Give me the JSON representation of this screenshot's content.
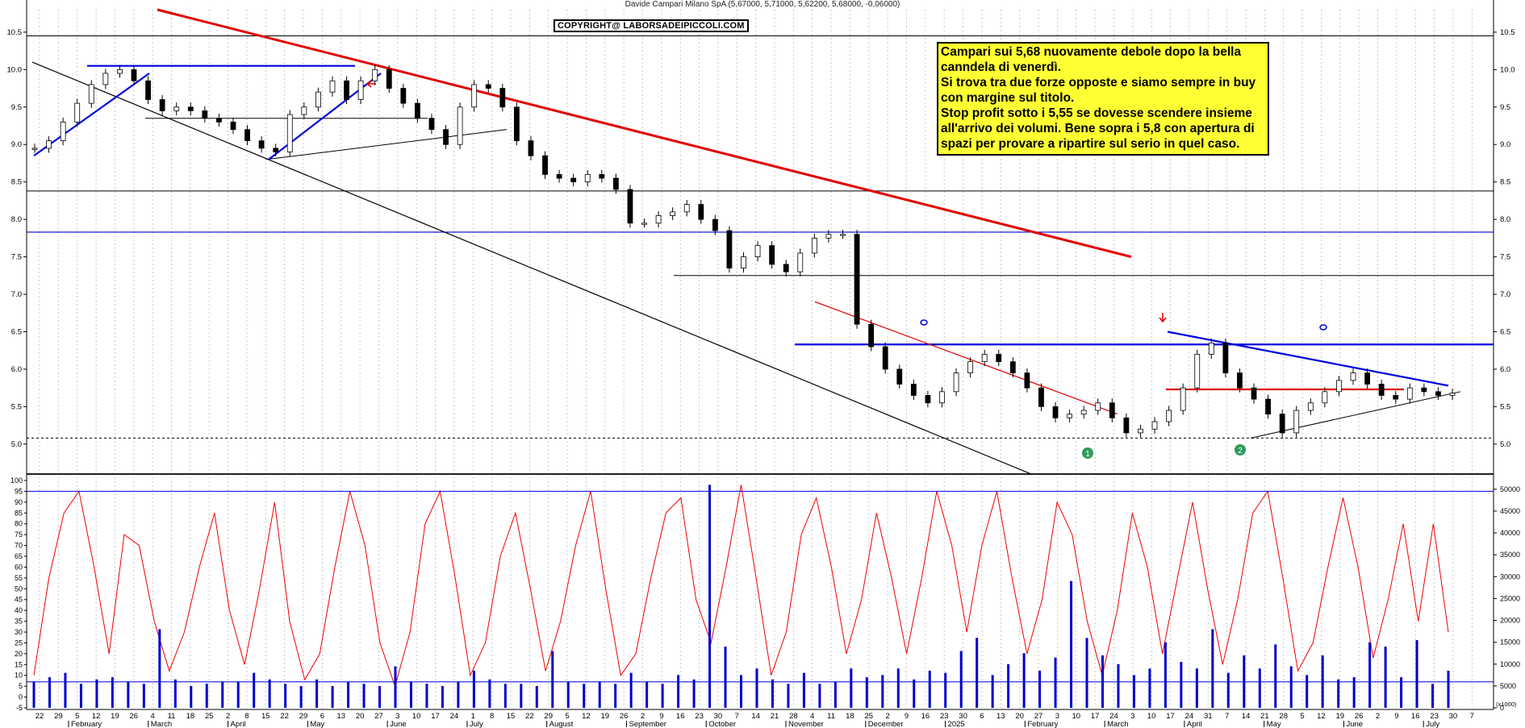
{
  "header": {
    "title": "Davide Campari Milano SpA (5,67000, 5,71000, 5,62200, 5,68000, -0,06000)"
  },
  "copyright": "COPYRIGHT@ LABORSADEIPICCOLI.COM",
  "note": {
    "lines": [
      "Campari sui 5,68 nuovamente debole dopo la bella canndela di venerdì.",
      "Si trova tra due forze opposte e siamo sempre in buy con margine sul titolo.",
      "Stop profit sotto i 5,55 se dovesse scendere insieme all'arrivo dei volumi. Bene sopra i 5,8 con apertura di spazi per provare a ripartire sul serio in quel caso."
    ]
  },
  "colors": {
    "price_candle": "#000000",
    "red_trend": "#e00000",
    "blue_line": "#0000dd",
    "oscillator": "#ee0000",
    "volume": "#0000cc",
    "note_bg": "#ffff33",
    "marker_green": "#2e9b5a"
  },
  "chart_data": [
    {
      "type": "candlestick",
      "title": "Davide Campari Milano SpA (5,67000, 5,71000, 5,62200, 5,68000, -0,06000)",
      "ylim": [
        4.6,
        10.8
      ],
      "y_ticks_left": [
        "10.5",
        "10.0",
        "9.5",
        "9.0",
        "8.5",
        "8.0",
        "7.5",
        "7.0",
        "6.5",
        "6.0",
        "5.5",
        "5.0"
      ],
      "y_ticks_right": [
        "10.5",
        "10.0",
        "9.5",
        "9.0",
        "8.5",
        "8.0",
        "7.5",
        "7.0",
        "6.5",
        "6.0",
        "5.5",
        "5.0"
      ],
      "x_day_labels": [
        "22",
        "29",
        "5",
        "12",
        "19",
        "26",
        "4",
        "11",
        "18",
        "25",
        "2",
        "8",
        "15",
        "22",
        "29",
        "6",
        "13",
        "20",
        "27",
        "3",
        "10",
        "17",
        "24",
        "1",
        "8",
        "15",
        "22",
        "29",
        "5",
        "12",
        "19",
        "26",
        "2",
        "9",
        "16",
        "23",
        "30",
        "7",
        "14",
        "21",
        "28",
        "4",
        "11",
        "18",
        "25",
        "2",
        "9",
        "16",
        "23",
        "30",
        "6",
        "13",
        "20",
        "27",
        "3",
        "10",
        "17",
        "24",
        "3",
        "10",
        "17",
        "24",
        "31",
        "7",
        "14",
        "21",
        "28",
        "5",
        "12",
        "19",
        "26",
        "2",
        "9",
        "16",
        "23",
        "30",
        "7"
      ],
      "x_month_labels": [
        "February",
        "March",
        "April",
        "May",
        "June",
        "July",
        "August",
        "September",
        "October",
        "November",
        "December",
        "2025",
        "February",
        "March",
        "April",
        "May",
        "June",
        "July"
      ],
      "closes": [
        8.95,
        9.05,
        9.3,
        9.55,
        9.8,
        9.95,
        10.0,
        9.85,
        9.6,
        9.45,
        9.5,
        9.45,
        9.35,
        9.3,
        9.2,
        9.05,
        8.95,
        8.9,
        9.4,
        9.5,
        9.7,
        9.85,
        9.6,
        9.85,
        10.0,
        9.75,
        9.55,
        9.35,
        9.2,
        9.0,
        9.5,
        9.8,
        9.75,
        9.5,
        9.05,
        8.85,
        8.6,
        8.55,
        8.5,
        8.6,
        8.55,
        8.4,
        7.95,
        7.95,
        8.05,
        8.1,
        8.2,
        8.0,
        7.85,
        7.35,
        7.5,
        7.65,
        7.4,
        7.3,
        7.55,
        7.75,
        7.8,
        7.8,
        6.6,
        6.3,
        6.0,
        5.8,
        5.65,
        5.55,
        5.7,
        5.95,
        6.1,
        6.2,
        6.1,
        5.95,
        5.75,
        5.5,
        5.35,
        5.4,
        5.45,
        5.55,
        5.35,
        5.15,
        5.2,
        5.3,
        5.45,
        5.75,
        6.2,
        6.35,
        5.95,
        5.75,
        5.6,
        5.4,
        5.15,
        5.45,
        5.55,
        5.7,
        5.85,
        5.95,
        5.8,
        5.65,
        5.6,
        5.75,
        5.7,
        5.65,
        5.68
      ],
      "horizontal_levels": [
        10.45,
        10.05,
        9.35,
        8.38,
        7.83,
        7.25,
        6.33,
        5.73,
        5.08
      ],
      "trendlines": [
        {
          "name": "red",
          "from": [
            "Jan",
            10.9
          ],
          "to": [
            "Nov",
            7.5
          ]
        },
        {
          "name": "black",
          "from": [
            "Jan",
            10.1
          ],
          "to": [
            "Dec",
            4.65
          ]
        }
      ],
      "markers": [
        "1",
        "2"
      ]
    },
    {
      "type": "line",
      "series": [
        {
          "values": [
            10,
            55,
            85,
            95,
            60,
            20,
            75,
            70,
            35,
            12,
            30,
            60,
            85,
            40,
            15,
            50,
            90,
            35,
            8,
            20,
            60,
            95,
            70,
            25,
            5,
            30,
            80,
            95,
            55,
            10,
            25,
            65,
            85,
            50,
            12,
            35,
            70,
            95,
            50,
            10,
            20,
            55,
            85,
            92,
            45,
            25,
            60,
            98,
            55,
            10,
            30,
            75,
            92,
            60,
            20,
            45,
            85,
            55,
            20,
            55,
            95,
            70,
            30,
            70,
            95,
            55,
            20,
            45,
            90,
            75,
            35,
            10,
            40,
            85,
            60,
            20,
            55,
            90,
            50,
            15,
            45,
            85,
            95,
            55,
            12,
            25,
            60,
            92,
            60,
            18,
            45,
            80,
            35,
            80,
            30
          ]
        }
      ],
      "ylim": [
        -5,
        100
      ],
      "y_ticks_left": [
        "100",
        "95",
        "90",
        "85",
        "80",
        "75",
        "70",
        "65",
        "60",
        "55",
        "50",
        "45",
        "40",
        "35",
        "30",
        "25",
        "20",
        "15",
        "10",
        "5",
        "0",
        "-5"
      ]
    },
    {
      "type": "bar",
      "series": [
        {
          "values": [
            6000,
            7000,
            8000,
            5500,
            6500,
            7000,
            6000,
            5500,
            18000,
            6500,
            5000,
            5500,
            6000,
            6000,
            8000,
            6500,
            5500,
            5000,
            6500,
            5000,
            6000,
            5500,
            5000,
            9500,
            6000,
            5500,
            5000,
            6000,
            8500,
            6500,
            5500,
            5500,
            5000,
            13000,
            6000,
            5500,
            6000,
            5500,
            8000,
            6000,
            5500,
            7500,
            6500,
            51000,
            14000,
            7500,
            9000,
            6500,
            5500,
            8000,
            5500,
            6000,
            9000,
            7000,
            7500,
            9000,
            6500,
            8500,
            8000,
            13000,
            16000,
            7500,
            10000,
            12500,
            8500,
            11500,
            29000,
            16000,
            12000,
            10000,
            7500,
            9000,
            15000,
            10500,
            9000,
            18000,
            8000,
            12000,
            9000,
            14500,
            9500,
            7500,
            12000,
            6500,
            7000,
            15000,
            14000,
            7000,
            15500,
            5500,
            8500
          ]
        }
      ],
      "ylim": [
        0,
        52000
      ],
      "y_ticks_right": [
        "50000",
        "45000",
        "40000",
        "35000",
        "30000",
        "25000",
        "20000",
        "15000",
        "10000",
        "5000",
        "0"
      ],
      "scale_label": "(x1000)"
    }
  ]
}
